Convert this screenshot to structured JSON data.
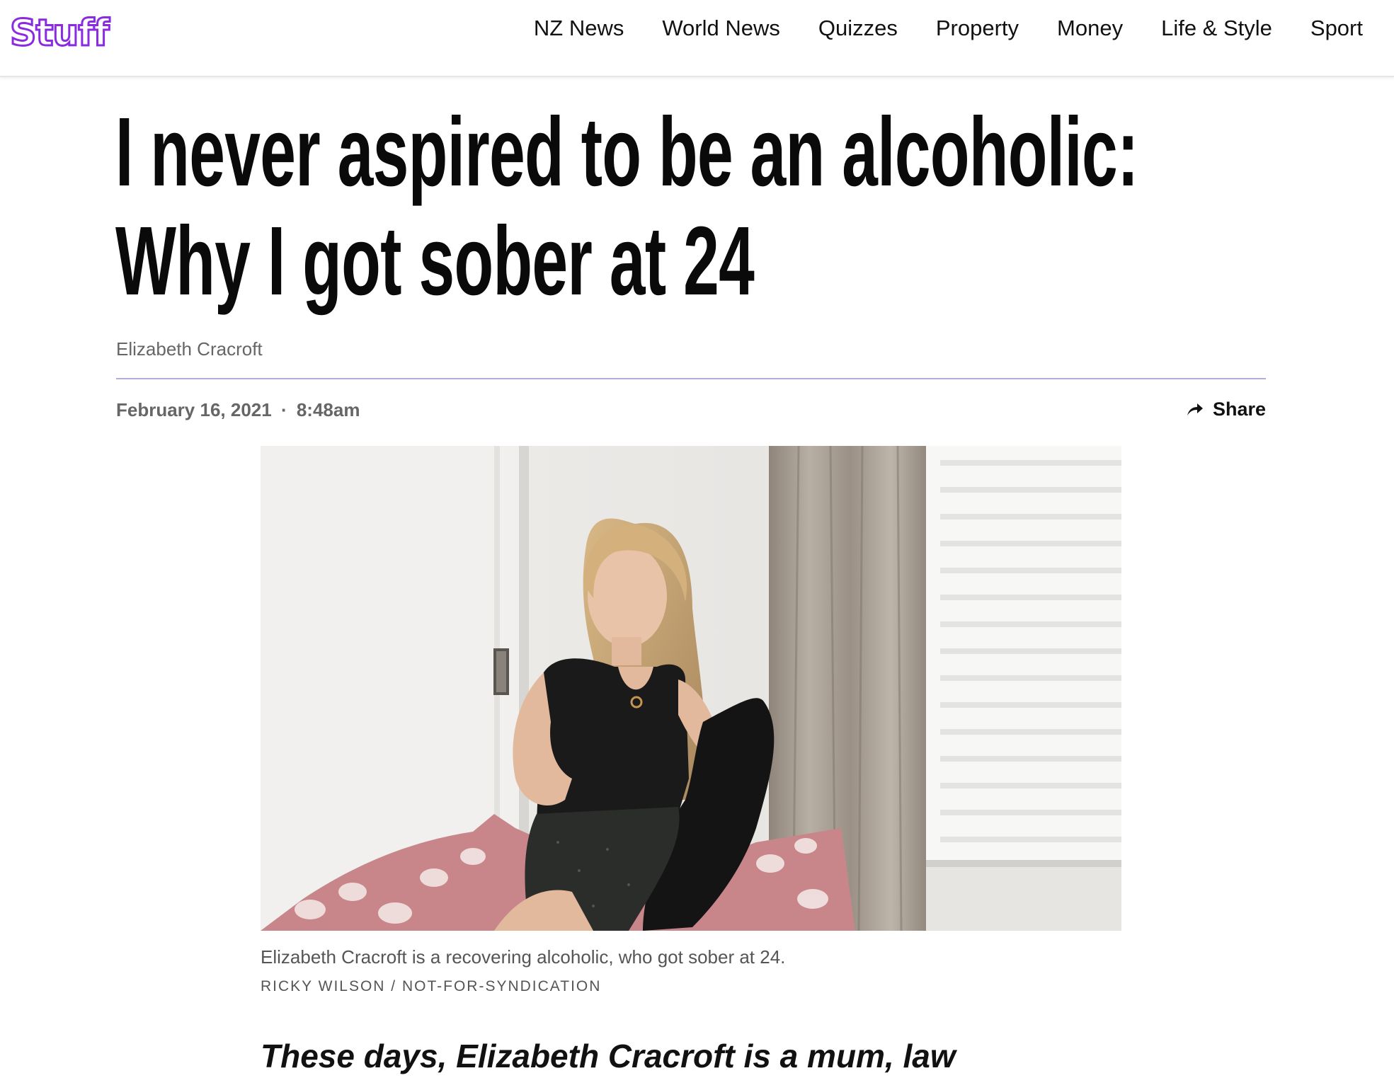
{
  "header": {
    "logo_text": "Stuff",
    "logo_color": "#8a2be2",
    "nav": [
      {
        "label": "NZ News"
      },
      {
        "label": "World News"
      },
      {
        "label": "Quizzes"
      },
      {
        "label": "Property"
      },
      {
        "label": "Money"
      },
      {
        "label": "Life & Style"
      },
      {
        "label": "Sport"
      }
    ]
  },
  "article": {
    "headline_line1": "I never aspired to be an alcoholic:",
    "headline_line2": "Why I got sober at 24",
    "author": "Elizabeth Cracroft",
    "date": "February 16, 2021",
    "separator": "·",
    "time": "8:48am",
    "share_label": "Share",
    "share_icon": "share-arrow-icon",
    "image": {
      "caption": "Elizabeth Cracroft is a recovering alcoholic, who got sober at 24.",
      "credit": "RICKY WILSON / NOT-FOR-SYNDICATION"
    },
    "standfirst": "These days, Elizabeth Cracroft is a mum, law"
  },
  "colors": {
    "accent": "#8a2be2",
    "rule": "#b4acd8"
  }
}
